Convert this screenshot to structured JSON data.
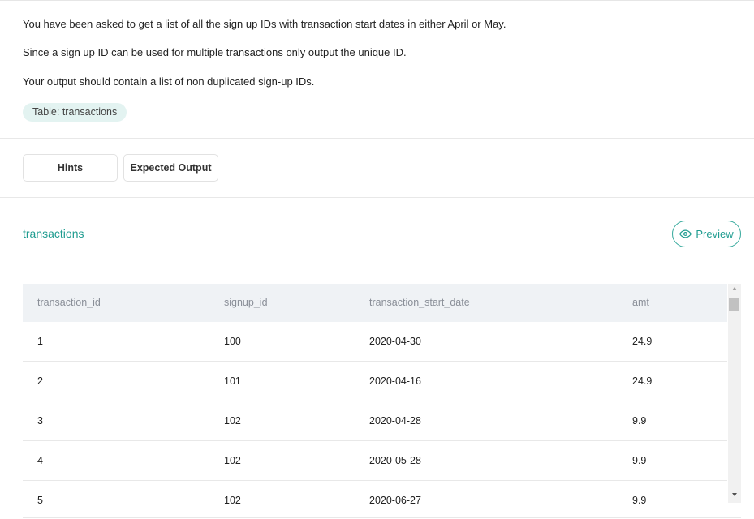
{
  "description": {
    "line1": "You have been asked to get a list of all the sign up IDs with transaction start dates in either April or May.",
    "line2": "Since a sign up ID can be used for multiple transactions only output the unique ID.",
    "line3": "Your output should contain a list of non duplicated sign-up IDs."
  },
  "table_chip": "Table: transactions",
  "buttons": {
    "hints": "Hints",
    "expected_output": "Expected Output"
  },
  "section": {
    "title": "transactions",
    "preview_label": "Preview",
    "preview_icon": "eye-icon"
  },
  "table": {
    "columns": [
      "transaction_id",
      "signup_id",
      "transaction_start_date",
      "amt"
    ],
    "rows": [
      [
        "1",
        "100",
        "2020-04-30",
        "24.9"
      ],
      [
        "2",
        "101",
        "2020-04-16",
        "24.9"
      ],
      [
        "3",
        "102",
        "2020-04-28",
        "9.9"
      ],
      [
        "4",
        "102",
        "2020-05-28",
        "9.9"
      ],
      [
        "5",
        "102",
        "2020-06-27",
        "9.9"
      ]
    ]
  },
  "colors": {
    "accent": "#1f9c90",
    "chip_bg": "#e3f3f1",
    "header_bg": "#eff2f5"
  }
}
